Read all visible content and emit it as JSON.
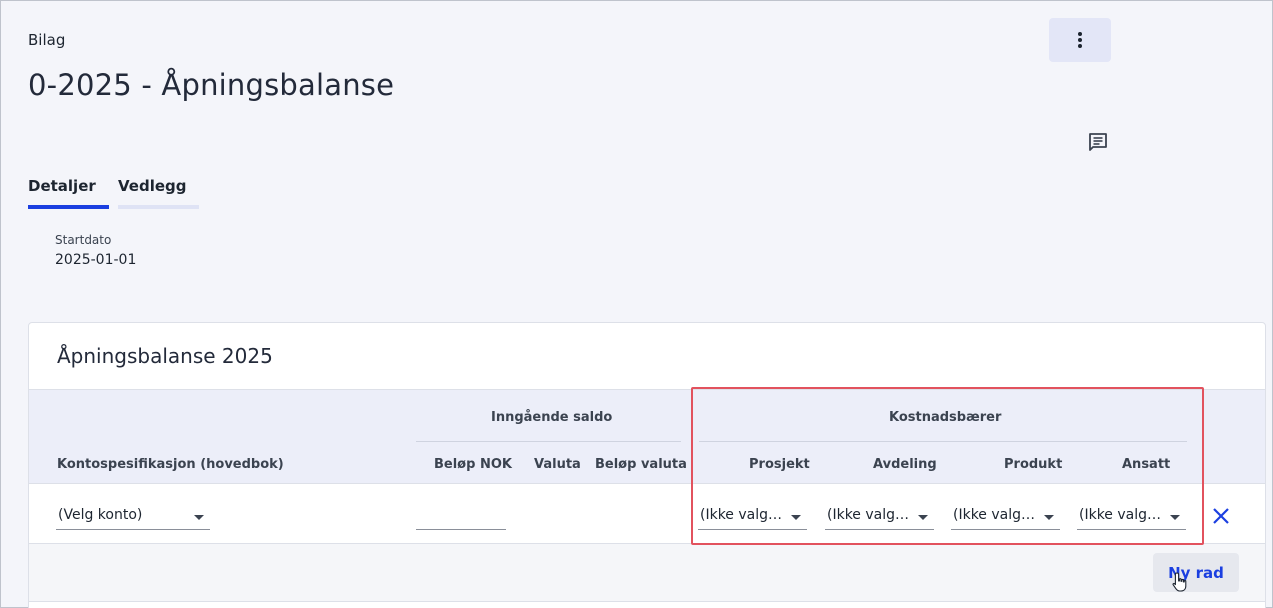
{
  "header": {
    "breadcrumb": "Bilag",
    "title": "0-2025 - Åpningsbalanse",
    "more_icon": "more-vertical-icon",
    "comment_icon": "comment-icon"
  },
  "tabs": [
    {
      "label": "Detaljer",
      "active": true
    },
    {
      "label": "Vedlegg",
      "active": false
    }
  ],
  "details": {
    "startdato_label": "Startdato",
    "startdato_value": "2025-01-01"
  },
  "card": {
    "title": "Åpningsbalanse 2025",
    "table": {
      "group_headers": {
        "opening_balance": "Inngående saldo",
        "cost_carrier": "Kostnadsbærer"
      },
      "columns": {
        "account": "Kontospesifikasjon (hovedbok)",
        "amount_nok": "Beløp NOK",
        "currency": "Valuta",
        "amount_currency": "Beløp valuta",
        "project": "Prosjekt",
        "department": "Avdeling",
        "product": "Produkt",
        "employee": "Ansatt"
      },
      "row": {
        "account": "(Velg konto)",
        "amount_nok": "",
        "project": "(Ikke valg…",
        "department": "(Ikke valg…",
        "product": "(Ikke valg…",
        "employee": "(Ikke valg…"
      }
    },
    "new_row_label": "Ny rad"
  },
  "colors": {
    "accent": "#1b3fe0",
    "highlight": "#e2525e"
  }
}
